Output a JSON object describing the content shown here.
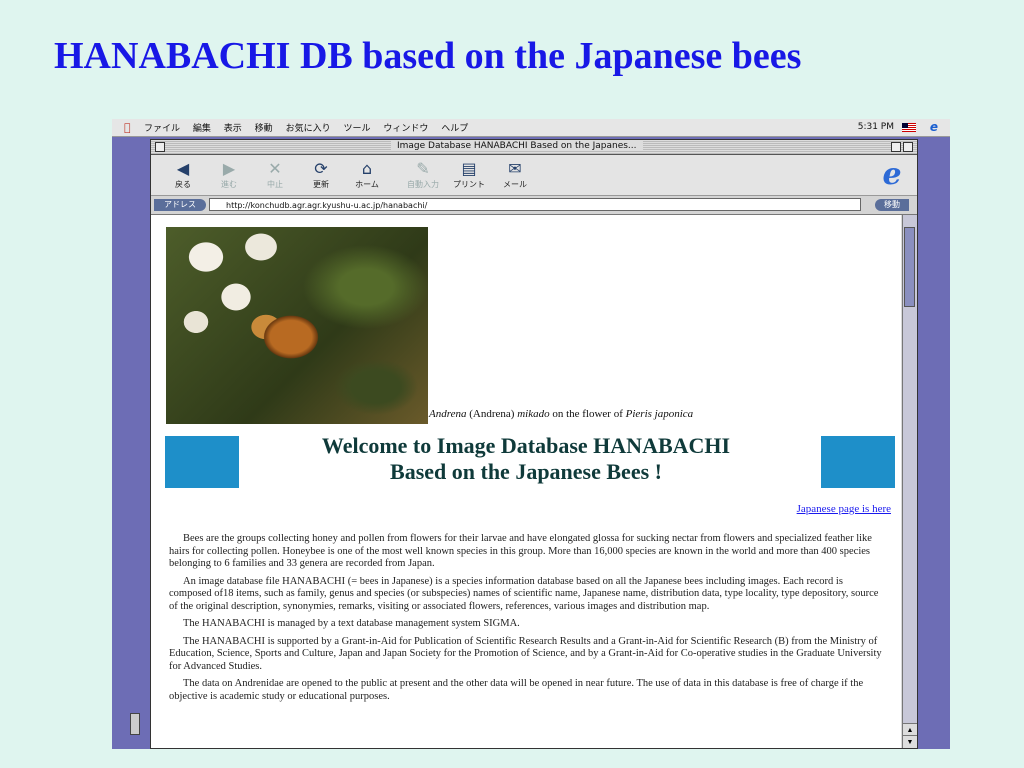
{
  "slide": {
    "title": "HANABACHI DB based on the Japanese bees"
  },
  "menubar": {
    "items": [
      "ファイル",
      "編集",
      "表示",
      "移動",
      "お気に入り",
      "ツール",
      "ウィンドウ",
      "ヘルプ"
    ],
    "clock": "5:31 PM"
  },
  "window": {
    "title": "Image Database HANABACHI Based on the Japanes..."
  },
  "toolbar": {
    "back": "戻る",
    "forward": "進む",
    "stop": "中止",
    "refresh": "更新",
    "home": "ホーム",
    "autofill": "自動入力",
    "print": "プリント",
    "mail": "メール"
  },
  "address": {
    "label": "アドレス",
    "url": "http://konchudb.agr.agr.kyushu-u.ac.jp/hanabachi/",
    "go": "移動"
  },
  "page": {
    "caption_genus": "Andrena",
    "caption_subgenus": "(Andrena)",
    "caption_species": "mikado",
    "caption_mid": " on the flower of ",
    "caption_plant": "Pieris japonica",
    "welcome_line1": "Welcome to Image Database HANABACHI",
    "welcome_line2": "Based on the Japanese Bees !",
    "japanese_link": "Japanese page is here",
    "paragraphs": [
      "Bees are the groups collecting honey and pollen from flowers for their larvae and have elongated glossa for sucking nectar from flowers and specialized feather like hairs for collecting pollen. Honeybee is one of the most well known species in this group. More than 16,000 species are known in the world and more than 400 species belonging to 6 families and 33 genera are recorded from Japan.",
      "An image database file HANABACHI (= bees in Japanese) is a species information database based on all the Japanese bees including images. Each record is composed of18 items, such as family, genus and species (or subspecies) names of scientific name, Japanese name, distribution data, type locality, type depository, source of the original description, synonymies, remarks, visiting or associated flowers, references, various images and distribution map.",
      "The HANABACHI is managed by a text database management system SIGMA.",
      "The HANABACHI is supported by a Grant-in-Aid for Publication of Scientific Research Results and a Grant-in-Aid for Scientific Research (B) from the Ministry of Education, Science, Sports and Culture, Japan and Japan Society for the Promotion of Science, and by a Grant-in-Aid for Co-operative studies in the Graduate University for Advanced Studies.",
      "The data on Andrenidae are opened to the public at present and the other data will be opened in near future. The use of data in this database is free of charge if the objective is academic study or educational purposes."
    ]
  },
  "colors": {
    "title": "#1818e6",
    "accent_box": "#1e8fc9",
    "desktop": "#6d6db5",
    "background": "#dff5ef"
  }
}
